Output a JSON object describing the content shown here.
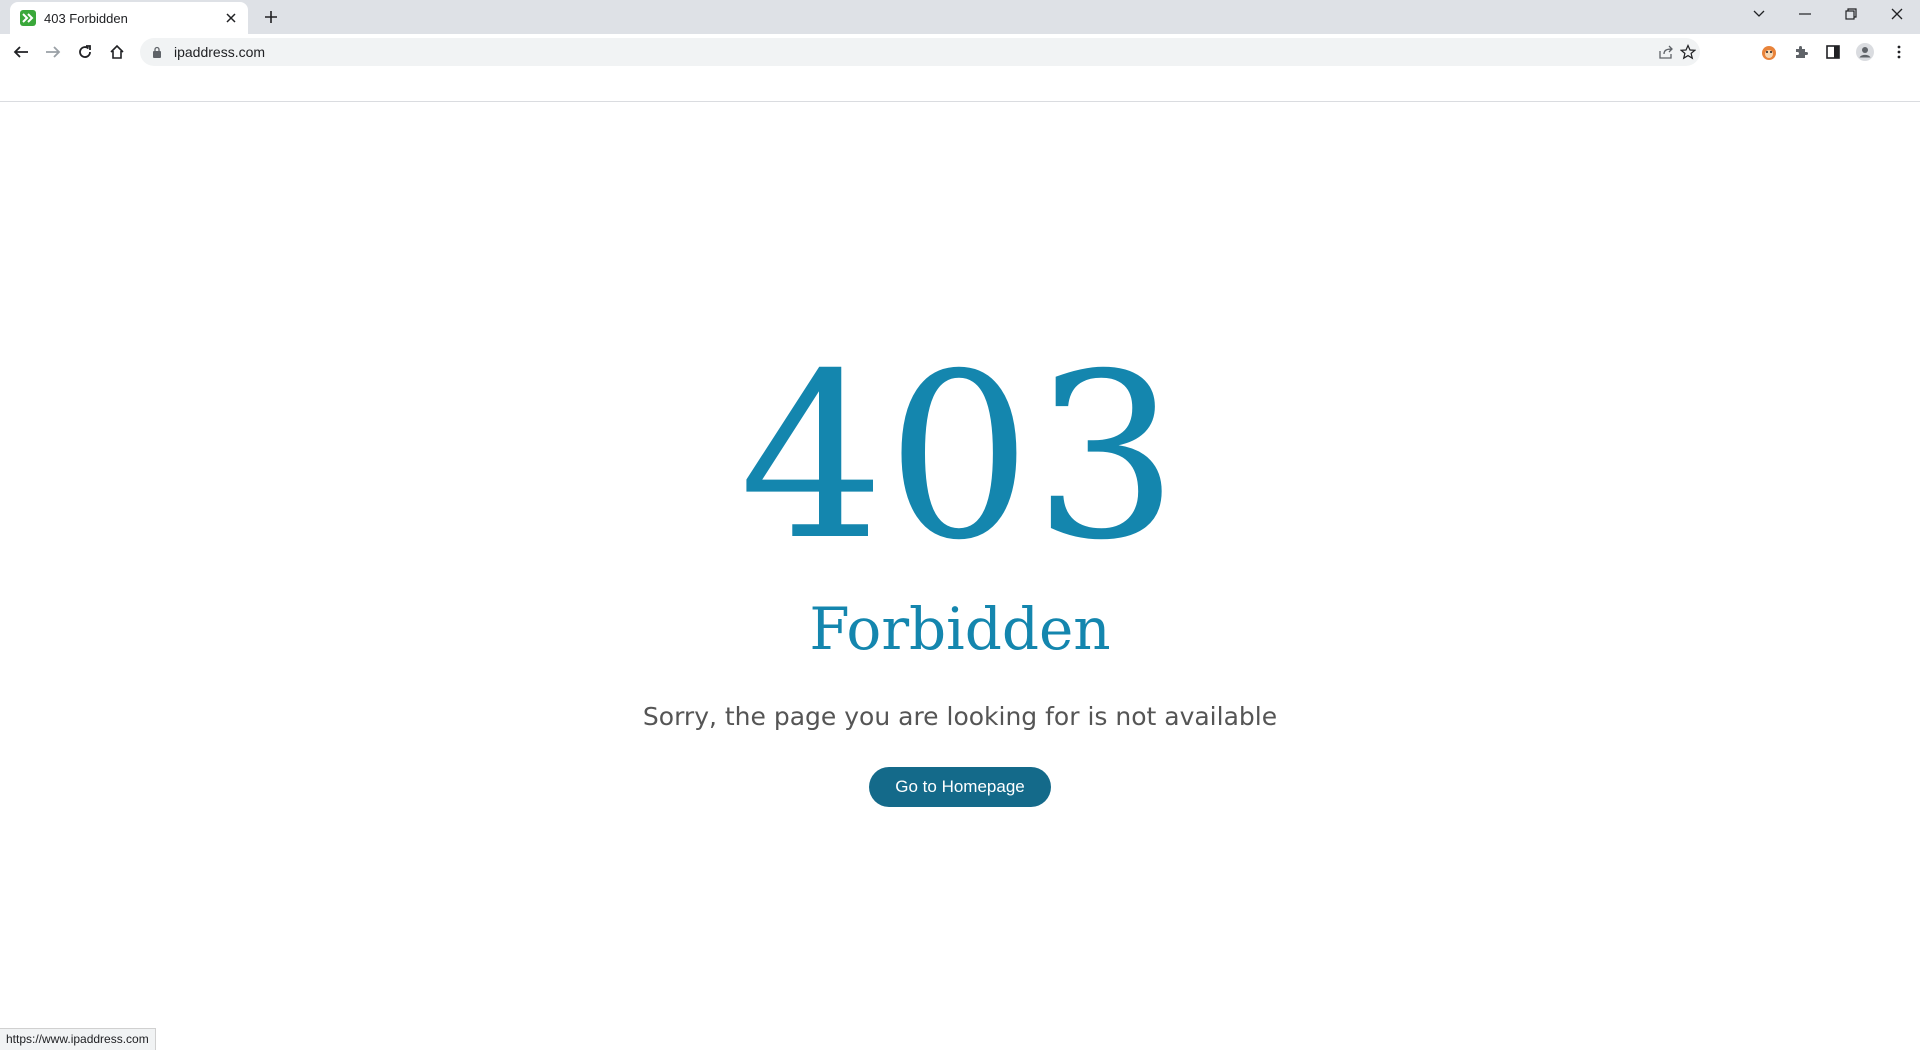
{
  "browser": {
    "tab": {
      "title": "403 Forbidden",
      "favicon": "ipaddress-favicon-icon",
      "favicon_color": "#3aa83a"
    },
    "address_bar": {
      "url": "ipaddress.com"
    },
    "status_url": "https://www.ipaddress.com"
  },
  "page": {
    "error_code": "403",
    "error_title": "Forbidden",
    "message": "Sorry, the page you are looking for is not available",
    "button_label": "Go to Homepage"
  },
  "colors": {
    "accent": "#1486ae",
    "button": "#146a8a",
    "message_text": "#555555"
  }
}
